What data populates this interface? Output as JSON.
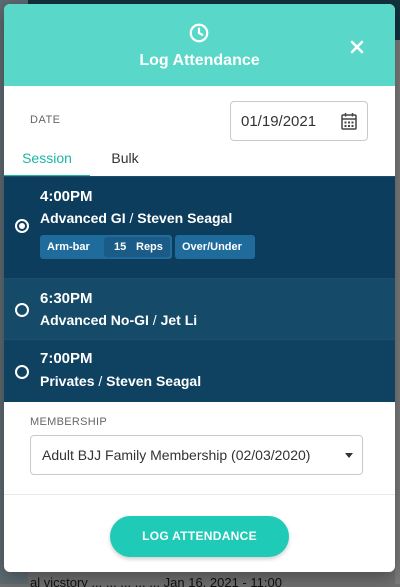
{
  "background": {
    "bottom_text": "al  vicstory ...   ...   ...   ... ... Jan 16, 2021 - 11:00"
  },
  "modal": {
    "title": "Log Attendance",
    "header_icon": "clock-icon",
    "close_icon": "close-icon"
  },
  "date": {
    "label": "DATE",
    "value": "01/19/2021",
    "icon": "calendar-icon"
  },
  "tabs": [
    {
      "label": "Session",
      "active": true
    },
    {
      "label": "Bulk",
      "active": false
    }
  ],
  "sessions": [
    {
      "time": "4:00PM",
      "class_name": "Advanced GI",
      "separator": "/",
      "instructor": "Steven Seagal",
      "selected": true,
      "tags": {
        "armbar": "Arm-bar",
        "reps_count": "15",
        "reps_label": "Reps",
        "overunder": "Over/Under"
      }
    },
    {
      "time": "6:30PM",
      "class_name": "Advanced No-GI",
      "separator": "/",
      "instructor": "Jet Li",
      "selected": false
    },
    {
      "time": "7:00PM",
      "class_name": "Privates",
      "separator": "/",
      "instructor": "Steven Seagal",
      "selected": false
    }
  ],
  "membership": {
    "label": "MEMBERSHIP",
    "selected": "Adult BJJ Family Membership (02/03/2020)"
  },
  "submit": {
    "label": "LOG ATTENDANCE"
  },
  "colors": {
    "header": "#59d7c8",
    "accent": "#1ab7a4",
    "session_selected": "#0c3d5c",
    "tag": "#1f6b9c",
    "button": "#1fcab7"
  }
}
